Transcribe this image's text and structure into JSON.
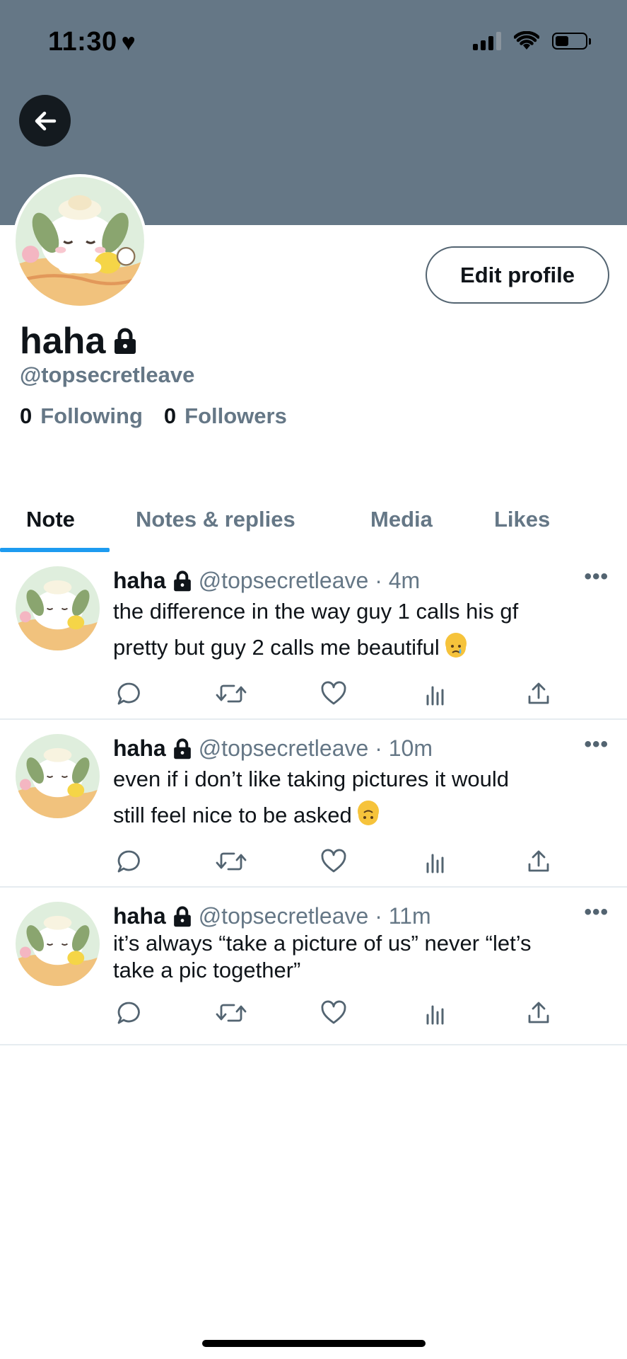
{
  "status_bar": {
    "time": "11:30",
    "heart": "♥"
  },
  "profile": {
    "display_name": "haha",
    "handle": "@topsecretleave",
    "following_count": "0",
    "following_label": "Following",
    "followers_count": "0",
    "followers_label": "Followers",
    "edit_label": "Edit profile"
  },
  "tabs": [
    {
      "label": "Note",
      "active": true
    },
    {
      "label": "Notes & replies",
      "active": false
    },
    {
      "label": "Media",
      "active": false
    },
    {
      "label": "Likes",
      "active": false
    }
  ],
  "tweets": [
    {
      "name": "haha",
      "meta": "@topsecretleave · 4m",
      "line1": "the difference in the way guy 1 calls his gf",
      "line2": "pretty but guy 2 calls me beautiful",
      "emoji": "crying-face"
    },
    {
      "name": "haha",
      "meta": "@topsecretleave · 10m",
      "line1": "even if i don’t like taking pictures it would",
      "line2": "still feel nice to be asked",
      "emoji": "upside-down-face"
    },
    {
      "name": "haha",
      "meta": "@topsecretleave · 11m",
      "line1": "it’s always “take a picture of us” never “let’s",
      "line2": "take a pic together”",
      "emoji": ""
    }
  ],
  "icons": {
    "back": "arrow-left-icon",
    "lock": "lock-icon",
    "reply": "reply-icon",
    "retweet": "retweet-icon",
    "like": "heart-icon",
    "views": "analytics-icon",
    "share": "share-icon",
    "more": "more-icon"
  },
  "colors": {
    "banner": "#657786",
    "accent": "#1d9bf0",
    "secondary_text": "#657786"
  }
}
